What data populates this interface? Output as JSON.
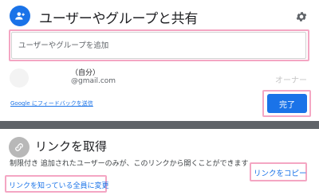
{
  "share": {
    "title": "ユーザーやグループと共有",
    "input_placeholder": "ユーザーやグループを追加",
    "user": {
      "name": "（自分）",
      "email": "@gmail.com",
      "role": "オーナー"
    },
    "feedback_link": "Google にフィードバックを送信",
    "done_label": "完了"
  },
  "link": {
    "title": "リンクを取得",
    "description": "制限付き 追加されたユーザーのみが、このリンクから開くことができます",
    "change_label": "リンクを知っている全員に変更",
    "copy_label": "リンクをコピー"
  },
  "colors": {
    "accent": "#1a73e8",
    "highlight": "#f4a6c3",
    "backdrop": "#5f6368"
  },
  "icons": [
    "add-person-icon",
    "gear-icon",
    "link-icon",
    "avatar"
  ]
}
